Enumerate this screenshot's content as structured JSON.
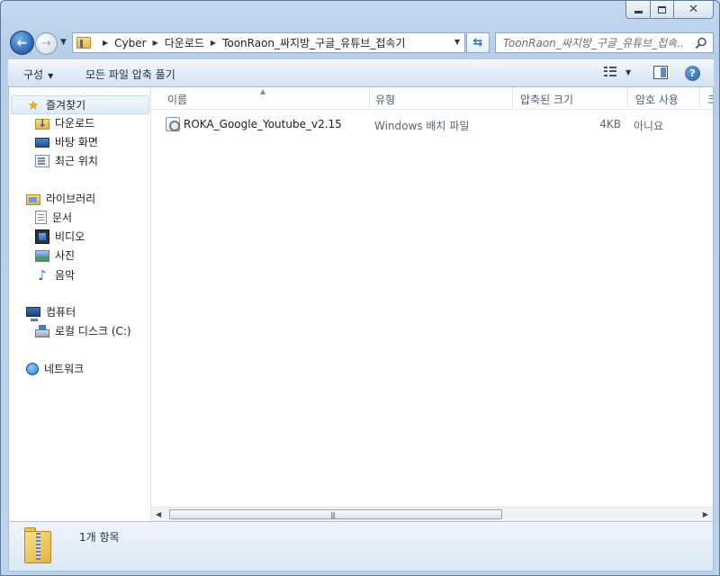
{
  "window": {
    "controls": {
      "minimize": "",
      "maximize": "",
      "close": "✕"
    }
  },
  "address_bar": {
    "crumbs": [
      "Cyber",
      "다운로드",
      "ToonRaon_싸지방_구글_유튜브_접속기"
    ]
  },
  "search": {
    "placeholder": "ToonRaon_싸지방_구글_유튜브_접속..."
  },
  "command_bar": {
    "organize": "구성",
    "extract_all": "모든 파일 압축 풀기"
  },
  "nav_pane": {
    "favorites": {
      "label": "즐겨찾기",
      "items": [
        "다운로드",
        "바탕 화면",
        "최근 위치"
      ]
    },
    "libraries": {
      "label": "라이브러리",
      "items": [
        "문서",
        "비디오",
        "사진",
        "음악"
      ]
    },
    "computer": {
      "label": "컴퓨터",
      "items": [
        "로컬 디스크 (C:)"
      ]
    },
    "network": {
      "label": "네트워크"
    }
  },
  "file_list": {
    "columns": [
      "이름",
      "유형",
      "압축된 크기",
      "암호 사용",
      "크"
    ],
    "rows": [
      {
        "name": "ROKA_Google_Youtube_v2.15",
        "type": "Windows 배치 파일",
        "size": "4KB",
        "password": "아니요"
      }
    ]
  },
  "status": {
    "item_count": "1개 항목"
  },
  "icons": {
    "favorites": "star-icon",
    "downloads": "downloads-folder-icon",
    "desktop": "desktop-icon",
    "recent": "recent-places-icon",
    "libraries": "library-icon",
    "documents": "documents-icon",
    "videos": "videos-icon",
    "pictures": "pictures-icon",
    "music": "music-icon",
    "computer": "computer-icon",
    "local_disk": "local-disk-icon",
    "network": "network-icon",
    "file": "batch-file-icon",
    "zip": "zip-folder-icon"
  },
  "colors": {
    "accent": "#2f6db5",
    "frame": "#c4d9ef"
  }
}
